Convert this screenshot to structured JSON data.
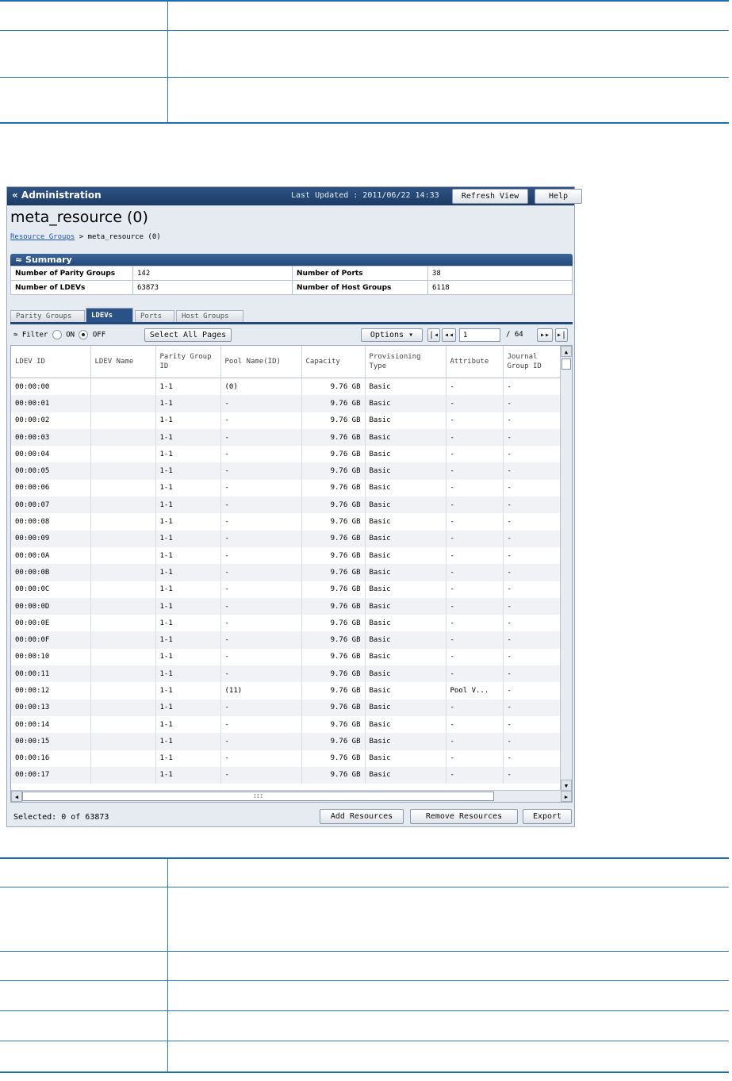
{
  "window": {
    "title": "« Administration",
    "last_updated": "Last Updated : 2011/06/22 14:33",
    "refresh_label": "Refresh View",
    "help_label": "Help"
  },
  "page": {
    "title": "meta_resource (0)",
    "breadcrumb_link": "Resource Groups",
    "breadcrumb_sep": ">",
    "breadcrumb_current": "meta_resource (0)"
  },
  "summary": {
    "header": "≈ Summary",
    "parity_groups_label": "Number of Parity Groups",
    "parity_groups_value": "142",
    "ports_label": "Number of Ports",
    "ports_value": "38",
    "ldevs_label": "Number of LDEVs",
    "ldevs_value": "63873",
    "host_groups_label": "Number of Host Groups",
    "host_groups_value": "6118"
  },
  "tabs": [
    "Parity Groups",
    "LDEVs",
    "Ports",
    "Host Groups"
  ],
  "toolbar": {
    "filter_label": "Filter",
    "on_label": "ON",
    "off_label": "OFF",
    "select_all_label": "Select All Pages",
    "options_label": "Options ▾",
    "page_value": "1",
    "page_total": "/ 64"
  },
  "columns": [
    "LDEV ID",
    "LDEV Name",
    "Parity Group ID",
    "Pool Name(ID)",
    "Capacity",
    "Provisioning Type",
    "Attribute",
    "Journal Group ID"
  ],
  "rows": [
    [
      "00:00:00",
      "",
      "1-1",
      "(0)",
      "9.76 GB",
      "Basic",
      "-",
      "-"
    ],
    [
      "00:00:01",
      "",
      "1-1",
      "-",
      "9.76 GB",
      "Basic",
      "-",
      "-"
    ],
    [
      "00:00:02",
      "",
      "1-1",
      "-",
      "9.76 GB",
      "Basic",
      "-",
      "-"
    ],
    [
      "00:00:03",
      "",
      "1-1",
      "-",
      "9.76 GB",
      "Basic",
      "-",
      "-"
    ],
    [
      "00:00:04",
      "",
      "1-1",
      "-",
      "9.76 GB",
      "Basic",
      "-",
      "-"
    ],
    [
      "00:00:05",
      "",
      "1-1",
      "-",
      "9.76 GB",
      "Basic",
      "-",
      "-"
    ],
    [
      "00:00:06",
      "",
      "1-1",
      "-",
      "9.76 GB",
      "Basic",
      "-",
      "-"
    ],
    [
      "00:00:07",
      "",
      "1-1",
      "-",
      "9.76 GB",
      "Basic",
      "-",
      "-"
    ],
    [
      "00:00:08",
      "",
      "1-1",
      "-",
      "9.76 GB",
      "Basic",
      "-",
      "-"
    ],
    [
      "00:00:09",
      "",
      "1-1",
      "-",
      "9.76 GB",
      "Basic",
      "-",
      "-"
    ],
    [
      "00:00:0A",
      "",
      "1-1",
      "-",
      "9.76 GB",
      "Basic",
      "-",
      "-"
    ],
    [
      "00:00:0B",
      "",
      "1-1",
      "-",
      "9.76 GB",
      "Basic",
      "-",
      "-"
    ],
    [
      "00:00:0C",
      "",
      "1-1",
      "-",
      "9.76 GB",
      "Basic",
      "-",
      "-"
    ],
    [
      "00:00:0D",
      "",
      "1-1",
      "-",
      "9.76 GB",
      "Basic",
      "-",
      "-"
    ],
    [
      "00:00:0E",
      "",
      "1-1",
      "-",
      "9.76 GB",
      "Basic",
      "-",
      "-"
    ],
    [
      "00:00:0F",
      "",
      "1-1",
      "-",
      "9.76 GB",
      "Basic",
      "-",
      "-"
    ],
    [
      "00:00:10",
      "",
      "1-1",
      "-",
      "9.76 GB",
      "Basic",
      "-",
      "-"
    ],
    [
      "00:00:11",
      "",
      "1-1",
      "-",
      "9.76 GB",
      "Basic",
      "-",
      "-"
    ],
    [
      "00:00:12",
      "",
      "1-1",
      "(11)",
      "9.76 GB",
      "Basic",
      "Pool V...",
      "-"
    ],
    [
      "00:00:13",
      "",
      "1-1",
      "-",
      "9.76 GB",
      "Basic",
      "-",
      "-"
    ],
    [
      "00:00:14",
      "",
      "1-1",
      "-",
      "9.76 GB",
      "Basic",
      "-",
      "-"
    ],
    [
      "00:00:15",
      "",
      "1-1",
      "-",
      "9.76 GB",
      "Basic",
      "-",
      "-"
    ],
    [
      "00:00:16",
      "",
      "1-1",
      "-",
      "9.76 GB",
      "Basic",
      "-",
      "-"
    ],
    [
      "00:00:17",
      "",
      "1-1",
      "-",
      "9.76 GB",
      "Basic",
      "-",
      "-"
    ]
  ],
  "hscroll_grip": "III",
  "footer": {
    "selected_text": "Selected:  0   of  63873",
    "add_label": "Add Resources",
    "remove_label": "Remove Resources",
    "export_label": "Export"
  }
}
